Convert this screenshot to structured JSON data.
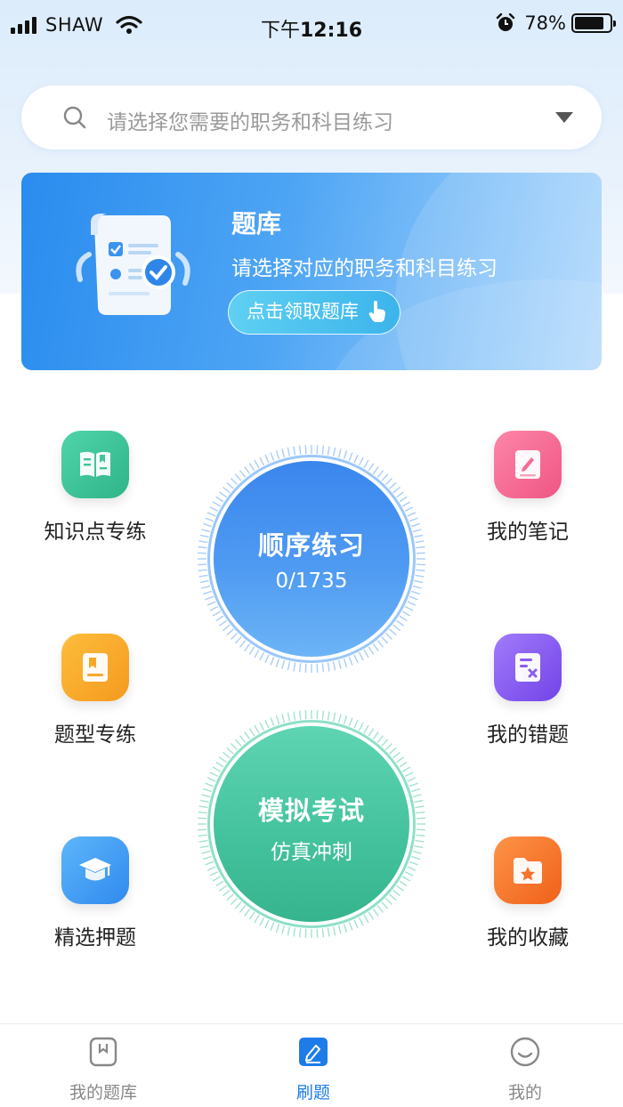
{
  "status_bar": {
    "carrier": "SHAW",
    "time_prefix": "下午",
    "time": "12:16",
    "battery": "78%"
  },
  "search": {
    "placeholder": "请选择您需要的职务和科目练习"
  },
  "banner": {
    "title": "题库",
    "subtitle": "请选择对应的职务和科目练习",
    "button_label": "点击领取题库"
  },
  "features": {
    "knowledge": {
      "label": "知识点专练",
      "icon": "book-icon",
      "color": "#3ec59b"
    },
    "question_type": {
      "label": "题型专练",
      "icon": "bookmark-book-icon",
      "color": "#f8a72b"
    },
    "selected": {
      "label": "精选押题",
      "icon": "graduation-cap-icon",
      "color": "#3d9bf2"
    },
    "notes": {
      "label": "我的笔记",
      "icon": "notebook-pen-icon",
      "color": "#f46b94"
    },
    "mistakes": {
      "label": "我的错题",
      "icon": "error-card-icon",
      "color": "#8b5bf0"
    },
    "favorites": {
      "label": "我的收藏",
      "icon": "star-folder-icon",
      "color": "#f5742c"
    }
  },
  "sequential": {
    "title": "顺序练习",
    "progress": "0/1735"
  },
  "mock_exam": {
    "title": "模拟考试",
    "subtitle": "仿真冲刺"
  },
  "tab_bar": {
    "items": [
      {
        "label": "我的题库",
        "icon": "bookmark-icon"
      },
      {
        "label": "刷题",
        "icon": "edit-icon"
      },
      {
        "label": "我的",
        "icon": "smile-icon"
      }
    ],
    "active_index": 1,
    "active_color": "#1e7ce8"
  }
}
